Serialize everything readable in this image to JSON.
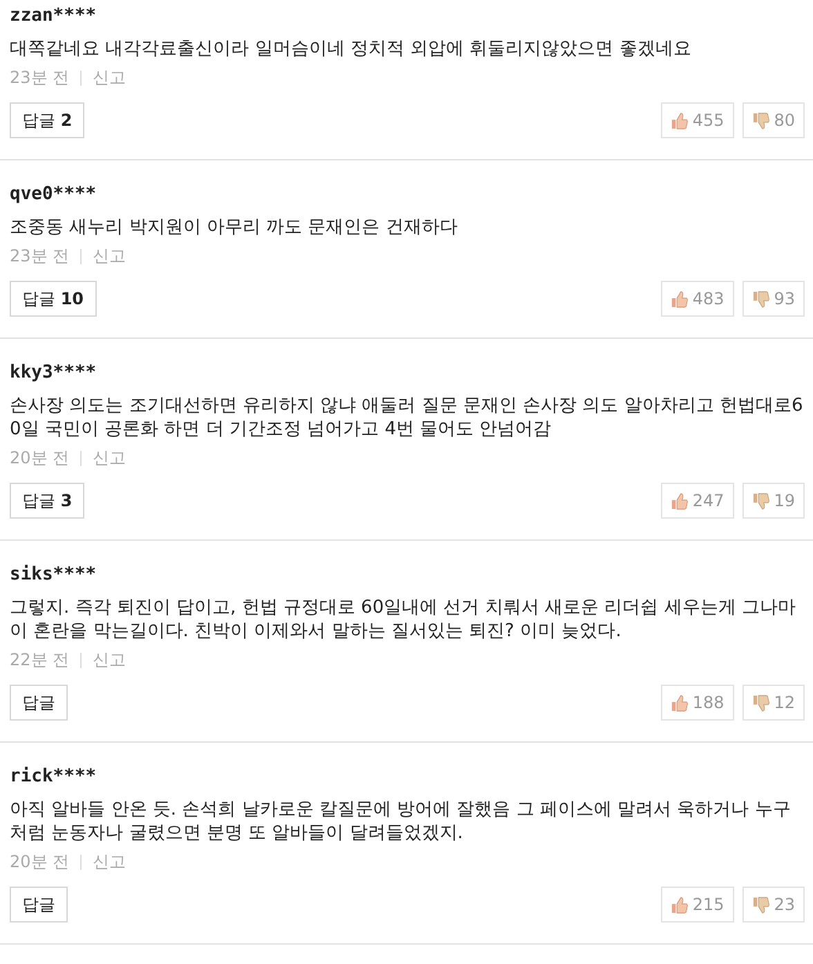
{
  "comments": [
    {
      "user": "zzan****",
      "text": "대쪽같네요 내각각료출신이라 일머슴이네 정치적 외압에 휘둘리지않았으면 좋겠네요",
      "time": "23분 전",
      "report": "신고",
      "reply": "답글 **2**",
      "likes": "455",
      "dislikes": "80"
    },
    {
      "user": "qve0****",
      "text": "조중동 새누리 박지원이 아무리 까도 문재인은 건재하다",
      "time": "23분 전",
      "report": "신고",
      "reply": "답글 **10**",
      "likes": "483",
      "dislikes": "93"
    },
    {
      "user": "kky3****",
      "text": "손사장 의도는 조기대선하면 유리하지 않냐 애둘러 질문 문재인 손사장 의도 알아차리고 헌법대로60일 국민이 공론화 하면 더 기간조정 넘어가고 4번 물어도 안넘어감",
      "time": "20분 전",
      "report": "신고",
      "reply": "답글 **3**",
      "likes": "247",
      "dislikes": "19"
    },
    {
      "user": "siks****",
      "text": "그렇지. 즉각 퇴진이 답이고, 헌법 규정대로 60일내에 선거 치뤄서 새로운 리더쉽 세우는게 그나마 이 혼란을 막는길이다. 친박이 이제와서 말하는 질서있는 퇴진? 이미 늦었다.",
      "time": "22분 전",
      "report": "신고",
      "reply": "답글",
      "likes": "188",
      "dislikes": "12"
    },
    {
      "user": "rick****",
      "text": "아직 알바들 안온 듯. 손석희 날카로운 칼질문에 방어에 잘했음 그 페이스에 말려서 욱하거나 누구처럼 눈동자나 굴렸으면 분명 또 알바들이 달려들었겠지.",
      "time": "20분 전",
      "report": "신고",
      "reply": "답글",
      "likes": "215",
      "dislikes": "23"
    }
  ]
}
